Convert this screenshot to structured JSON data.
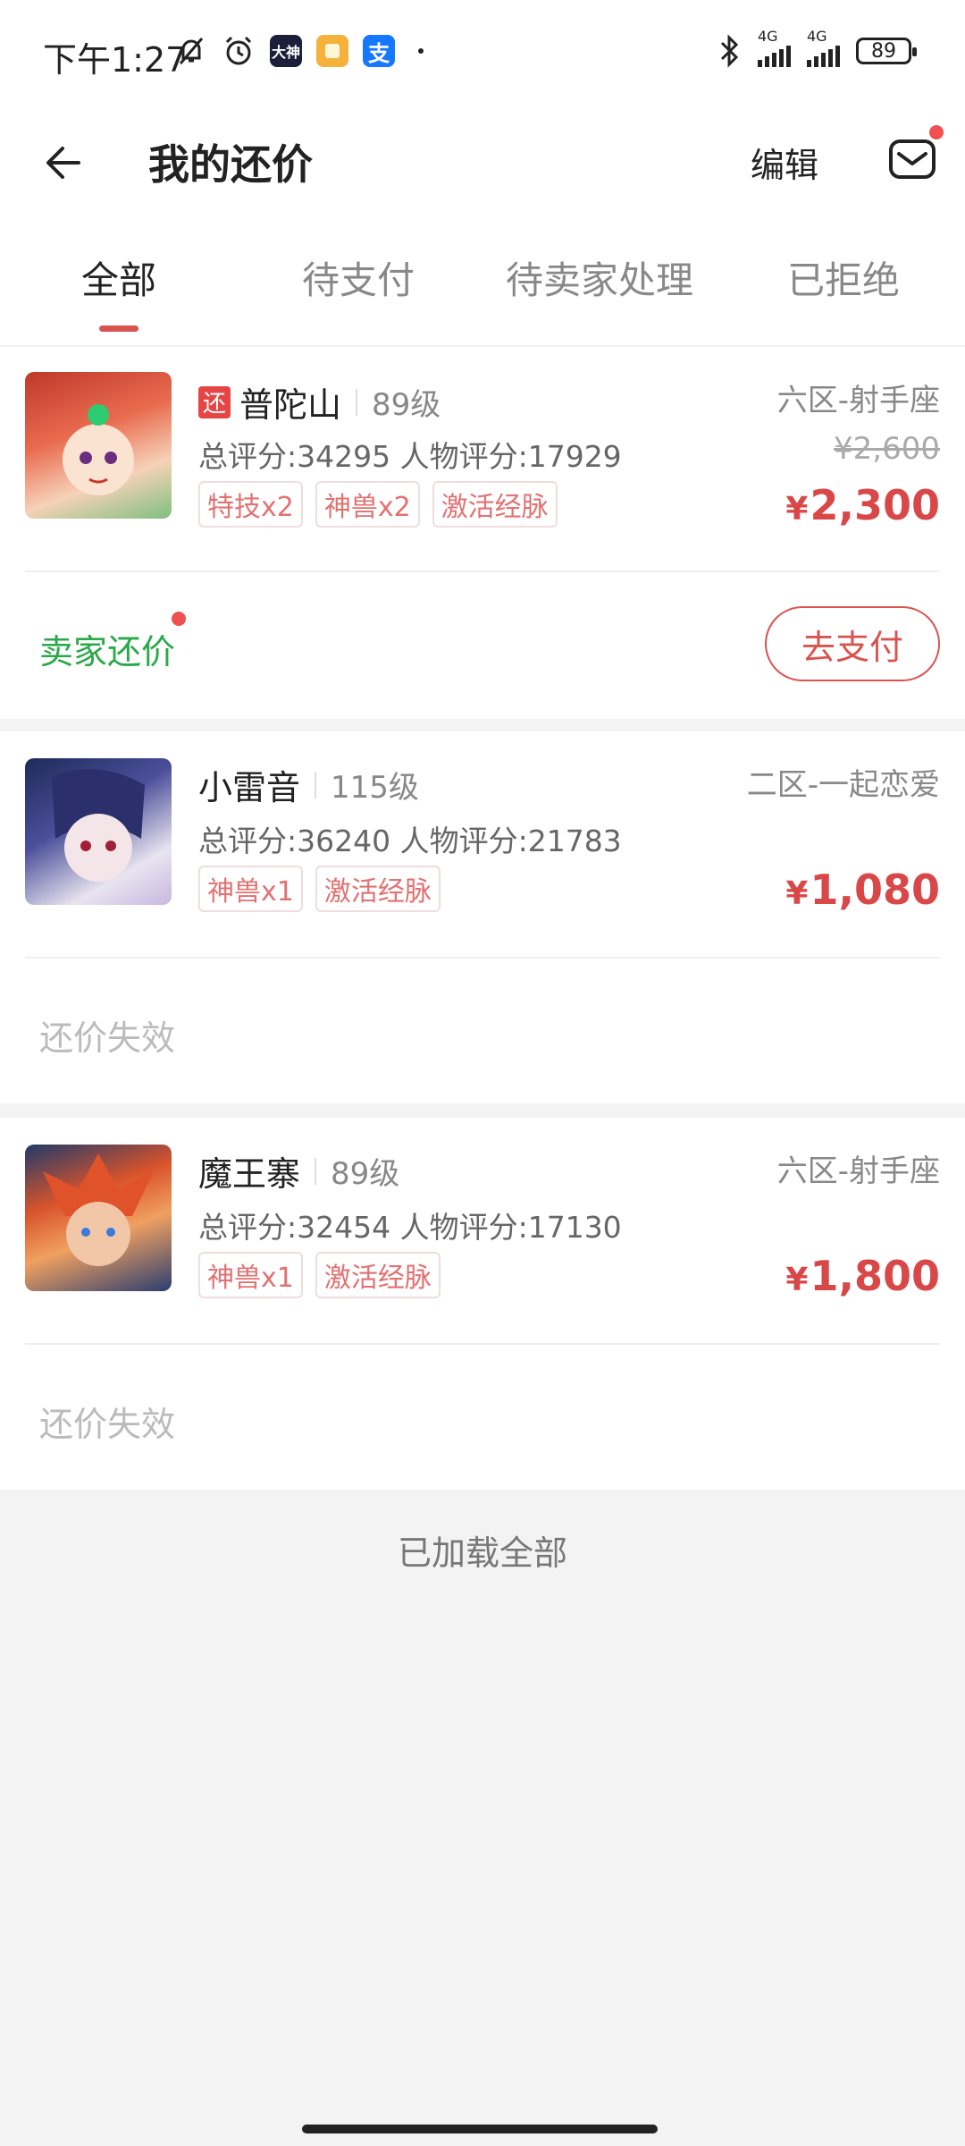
{
  "status_bar": {
    "time": "下午1:27",
    "app_icon_dashen": "大神",
    "app_icon_alipay": "支",
    "network_1": "4G",
    "network_2": "4G",
    "battery": "89",
    "icons": [
      "mute-bell-icon",
      "alarm-icon",
      "dashen-app-icon",
      "notes-app-icon",
      "alipay-app-icon",
      "bluetooth-icon",
      "signal-icon",
      "battery-icon"
    ]
  },
  "header": {
    "title": "我的还价",
    "edit_label": "编辑",
    "back_icon": "back-arrow-icon",
    "mail_icon": "mail-icon"
  },
  "tabs": [
    {
      "label": "全部",
      "active": true
    },
    {
      "label": "待支付",
      "active": false
    },
    {
      "label": "待卖家处理",
      "active": false
    },
    {
      "label": "已拒绝",
      "active": false
    }
  ],
  "items": [
    {
      "badge": "还",
      "name": "普陀山",
      "level": "89级",
      "server": "六区-射手座",
      "score": "总评分:34295 人物评分:17929",
      "tags": [
        "特技x2",
        "神兽x2",
        "激活经脉"
      ],
      "original_price": "¥2,600",
      "price_symbol": "¥",
      "price": "2,300",
      "status": "卖家还价",
      "action": "去支付"
    },
    {
      "name": "小雷音",
      "level": "115级",
      "server": "二区-一起恋爱",
      "score": "总评分:36240 人物评分:21783",
      "tags": [
        "神兽x1",
        "激活经脉"
      ],
      "price_symbol": "¥",
      "price": "1,080",
      "status": "还价失效"
    },
    {
      "name": "魔王寨",
      "level": "89级",
      "server": "六区-射手座",
      "score": "总评分:32454 人物评分:17130",
      "tags": [
        "神兽x1",
        "激活经脉"
      ],
      "price_symbol": "¥",
      "price": "1,800",
      "status": "还价失效"
    }
  ],
  "footer": {
    "loaded_text": "已加载全部"
  },
  "colors": {
    "accent": "#d9534f",
    "green": "#2aa94a",
    "background": "#f3f3f3"
  }
}
